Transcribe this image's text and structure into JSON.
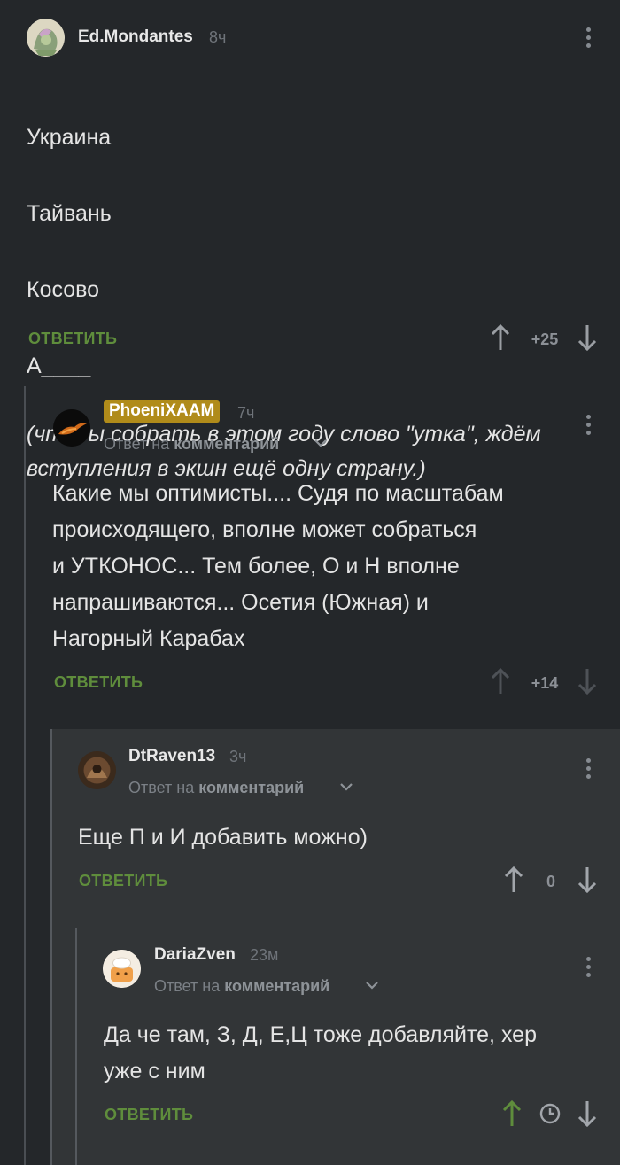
{
  "comments": [
    {
      "username": "Ed.Mondantes",
      "time": "8ч",
      "lines": [
        "Украина",
        "Тайвань",
        "Косово",
        "А____"
      ],
      "italic": "(чтобы собрать в этом году слово \"утка\", ждём\nвступления в экшн ещё одну страну.)",
      "reply_label": "ОТВЕТИТЬ",
      "score": "+25"
    },
    {
      "username": "PhoeniXAAM",
      "time": "7ч",
      "reply_prefix": "Ответ на",
      "reply_target": "комментарий",
      "text": "Какие мы оптимисты.... Судя по масштабам\nпроисходящего, вполне может собраться\nи УТКОНОС... Тем более, О и Н вполне\nнапрашиваются... Осетия (Южная) и\nНагорный Карабах",
      "reply_label": "ОТВЕТИТЬ",
      "score": "+14"
    },
    {
      "username": "DtRaven13",
      "time": "3ч",
      "reply_prefix": "Ответ на",
      "reply_target": "комментарий",
      "text": "Еще П и И добавить можно)",
      "reply_label": "ОТВЕТИТЬ",
      "score": "0"
    },
    {
      "username": "DariaZven",
      "time": "23м",
      "reply_prefix": "Ответ на",
      "reply_target": "комментарий",
      "text": "Да че там, З, Д, Е,Ц тоже добавляйте, хер\nуже с ним",
      "reply_label": "ОТВЕТИТЬ"
    }
  ],
  "colors": {
    "background": "#24272a",
    "nested_panel": "#323537",
    "accent_green": "#5f8d3c",
    "author_badge": "#b08b1a"
  }
}
